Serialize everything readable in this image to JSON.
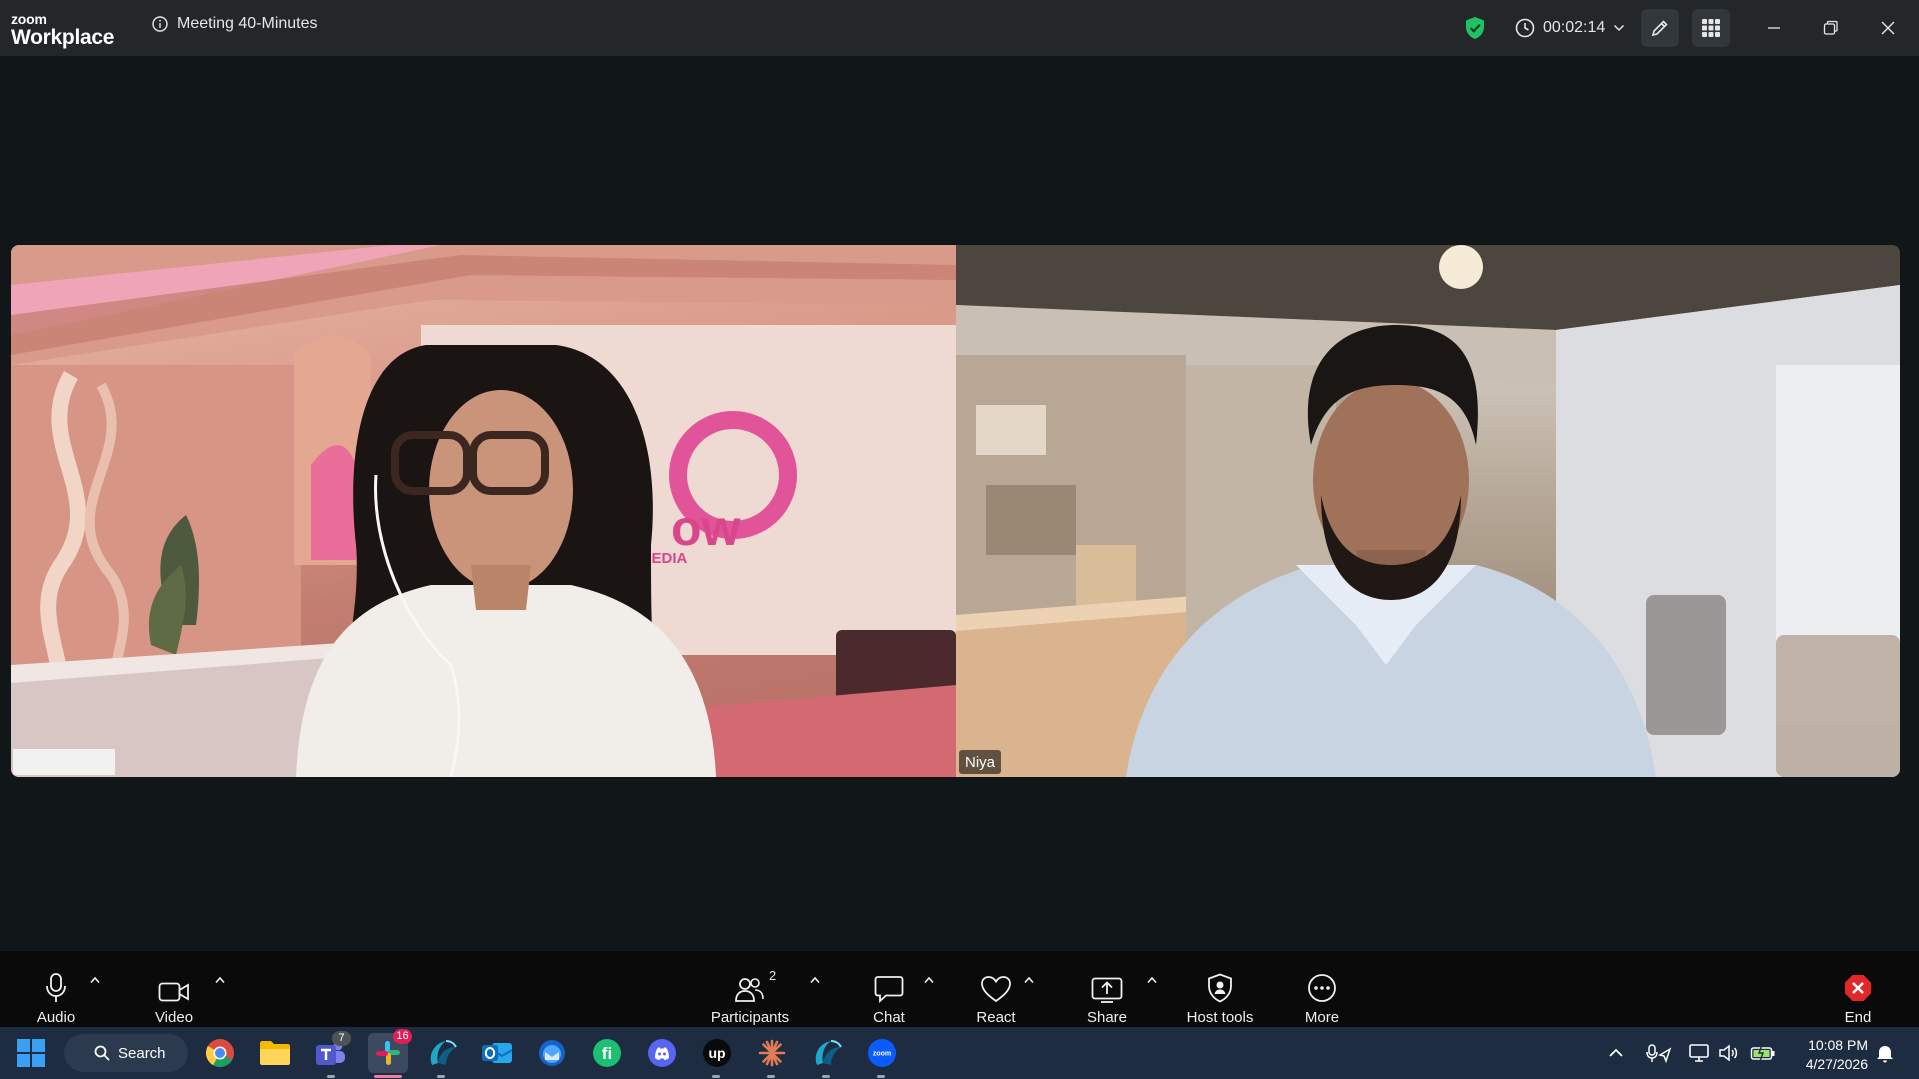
{
  "app": {
    "brand_small": "zoom",
    "brand_large": "Workplace"
  },
  "meeting": {
    "title": "Meeting 40-Minutes",
    "timer": "00:02:14"
  },
  "participants": [
    {
      "name": ""
    },
    {
      "name": "Niya"
    }
  ],
  "toolbar": {
    "audio": "Audio",
    "video": "Video",
    "participants": "Participants",
    "participants_count": "2",
    "chat": "Chat",
    "react": "React",
    "share": "Share",
    "host_tools": "Host tools",
    "more": "More",
    "end": "End"
  },
  "taskbar": {
    "search_label": "Search",
    "teams_badge": "7",
    "slack_badge": "16",
    "time": "10:08 PM",
    "date": "4/27/2026"
  },
  "colors": {
    "titlebar_bg": "#23272a",
    "stage_bg": "#111619",
    "toolbar_bg": "#0a0a0a",
    "taskbar_bg": "#1d2c40",
    "shield_green": "#21c266",
    "end_red": "#e02828"
  },
  "icons": [
    "info-icon",
    "shield-check-icon",
    "clock-icon",
    "chevron-down-icon",
    "pen-icon",
    "apps-grid-icon",
    "minimize-icon",
    "restore-icon",
    "close-icon",
    "microphone-icon",
    "camera-icon",
    "caret-up-icon",
    "participants-icon",
    "chat-icon",
    "heart-icon",
    "share-screen-icon",
    "host-shield-icon",
    "more-dots-icon",
    "end-icon",
    "windows-start-icon",
    "search-icon",
    "chrome-icon",
    "file-explorer-icon",
    "teams-icon",
    "slack-icon",
    "app-swirl-icon",
    "outlook-icon",
    "thunderbird-icon",
    "fiverr-icon",
    "discord-icon",
    "upwork-icon",
    "claude-icon",
    "zoom-icon",
    "tray-chevron-icon",
    "mic-location-icon",
    "network-icon",
    "volume-icon",
    "battery-icon",
    "notification-bell-icon"
  ]
}
